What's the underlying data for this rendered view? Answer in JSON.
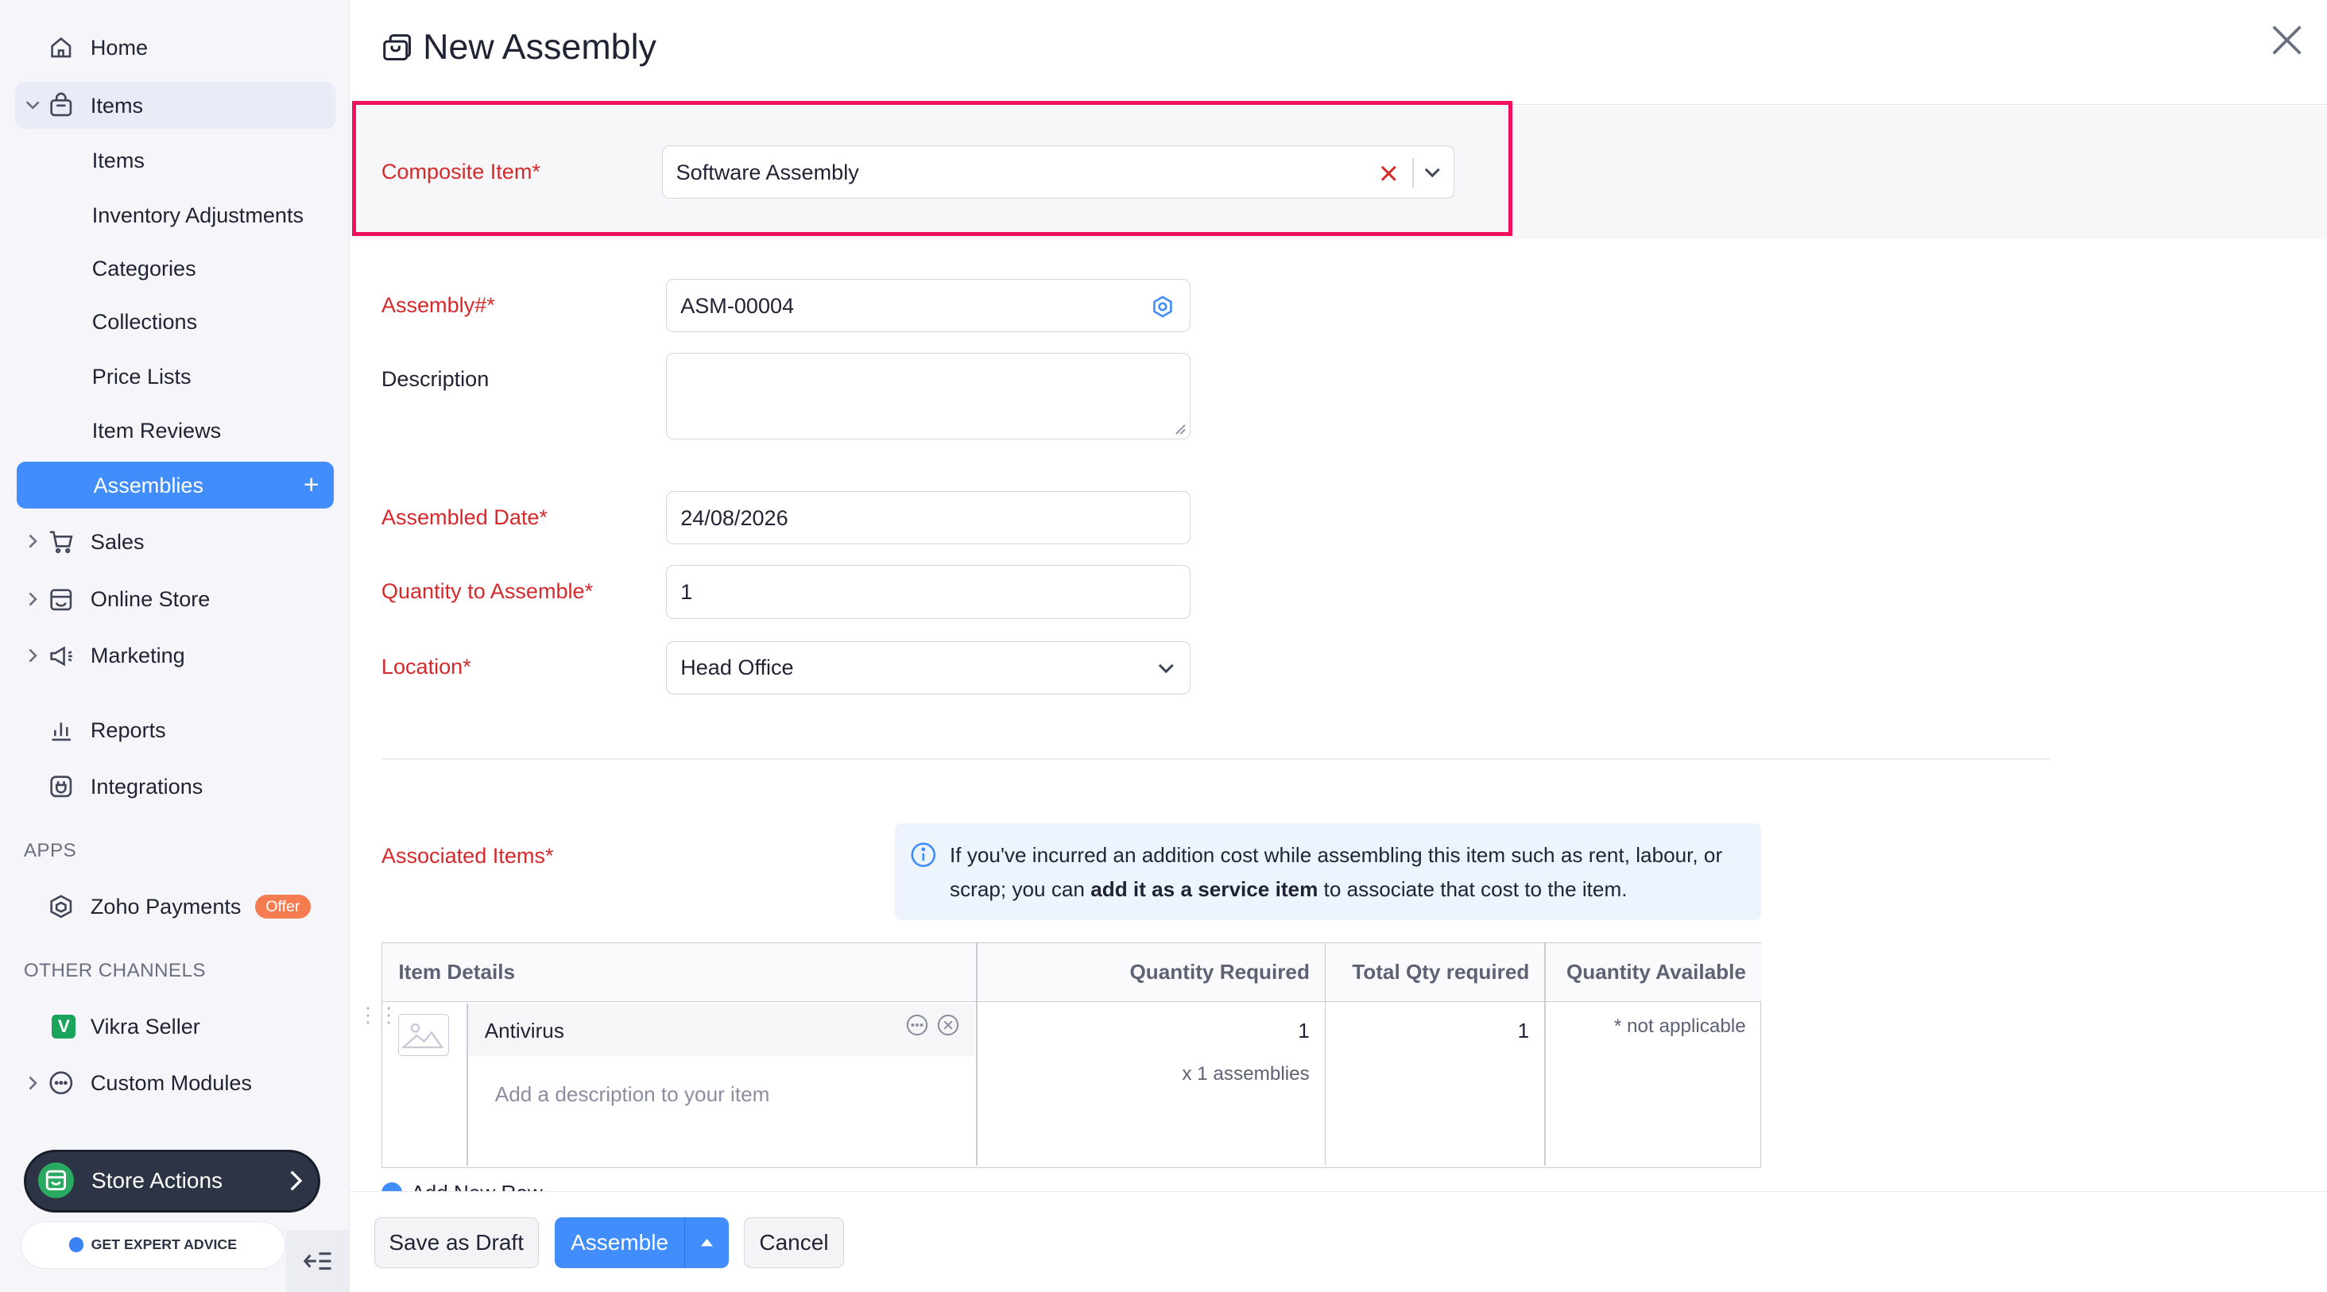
{
  "sidebar": {
    "home": "Home",
    "items_group": "Items",
    "sub_items": [
      "Items",
      "Inventory Adjustments",
      "Categories",
      "Collections",
      "Price Lists",
      "Item Reviews",
      "Assemblies"
    ],
    "sales": "Sales",
    "online_store": "Online Store",
    "marketing": "Marketing",
    "reports": "Reports",
    "integrations": "Integrations",
    "apps_header": "APPS",
    "zoho_payments": "Zoho Payments",
    "offer_badge": "Offer",
    "other_channels_header": "OTHER CHANNELS",
    "vikra_seller": "Vikra Seller",
    "custom_modules": "Custom Modules",
    "store_actions": "Store Actions",
    "expert_advice": "GET EXPERT ADVICE"
  },
  "header": {
    "title": "New Assembly"
  },
  "form": {
    "composite_item_label": "Composite Item*",
    "composite_item_value": "Software Assembly",
    "assembly_no_label": "Assembly#*",
    "assembly_no_value": "ASM-00004",
    "description_label": "Description",
    "description_value": "",
    "assembled_date_label": "Assembled Date*",
    "assembled_date_value": "24/08/2026",
    "quantity_label": "Quantity to Assemble*",
    "quantity_value": "1",
    "location_label": "Location*",
    "location_value": "Head Office",
    "associated_items_label": "Associated Items*"
  },
  "info_note": {
    "before": "If you've incurred an addition cost while assembling this item such as rent, labour, or scrap; you can ",
    "bold": "add it as a service item",
    "after": " to associate that cost to the item."
  },
  "table": {
    "headers": [
      "Item Details",
      "Quantity Required",
      "Total Qty required",
      "Quantity Available"
    ],
    "row": {
      "item_name": "Antivirus",
      "description_placeholder": "Add a description to your item",
      "quantity_required": "1",
      "assemblies_note": "x 1 assemblies",
      "total_qty": "1",
      "available": "* not applicable"
    },
    "add_row": "Add New Row"
  },
  "footer": {
    "save_draft": "Save as Draft",
    "assemble": "Assemble",
    "cancel": "Cancel"
  },
  "colors": {
    "accent": "#408dfb",
    "required": "#d6292c",
    "highlight": "#f0125e"
  }
}
